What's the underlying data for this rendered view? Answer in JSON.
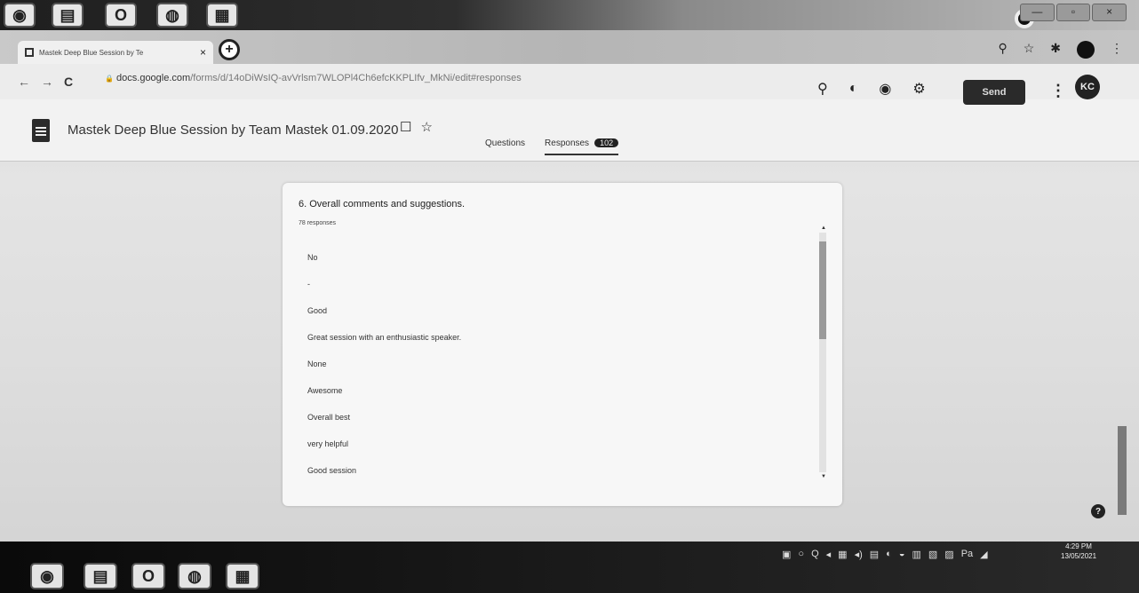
{
  "taskbar_top": {
    "icons": [
      "start-orb",
      "folder-icon",
      "opera-icon",
      "chrome-icon",
      "photo-icon"
    ]
  },
  "window_controls": [
    "—",
    "▫",
    "×"
  ],
  "tab": {
    "title": "Mastek Deep Blue Session by Te",
    "close": "×",
    "new_tab": "+"
  },
  "toolbar_right": [
    "⚲",
    "☆",
    "✱"
  ],
  "address": {
    "back": "←",
    "forward": "→",
    "reload": "C",
    "lock": "🔒",
    "host": "docs.google.com",
    "path": "/forms/d/14oDiWsIQ-avVrlsm7WLOPl4Ch6efcKKPLIfv_MkNi/edit#responses"
  },
  "form": {
    "title": "Mastek Deep Blue  Session by Team Mastek 01.09.2020",
    "folder_icon": "☐",
    "star_icon": "☆",
    "tools": [
      "⚲",
      "◐",
      "◉",
      "⚙"
    ],
    "send_label": "Send",
    "more": "⋮",
    "avatar": "KC",
    "tabs": {
      "questions": "Questions",
      "responses": "Responses",
      "response_count": "102"
    }
  },
  "question": {
    "title": "6. Overall comments and suggestions.",
    "count": "78 responses",
    "responses": [
      "No",
      "-",
      "Good",
      "Great session with an enthusiastic speaker.",
      "None",
      "Awesome",
      "Overall best",
      "very helpful",
      "Good session"
    ]
  },
  "help": "?",
  "taskbar": {
    "tray": [
      "▣",
      "○",
      "Q",
      "◂",
      "▦",
      "◂)",
      "▤",
      "◐",
      "◒",
      "▥",
      "▧",
      "▨",
      "Pa",
      "◢"
    ],
    "time": "4:29 PM",
    "date": "13/05/2021"
  }
}
